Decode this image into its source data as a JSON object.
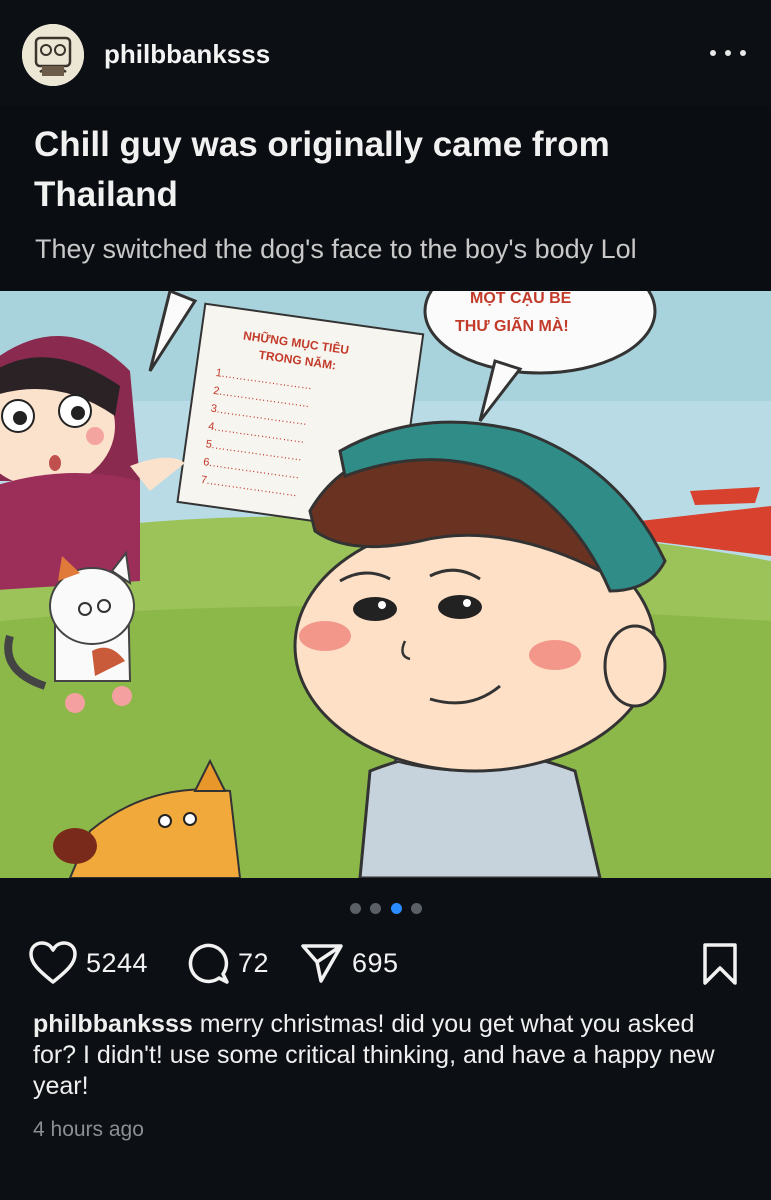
{
  "header": {
    "username": "philbbanksss",
    "more_icon": "more-horizontal-icon"
  },
  "embedded_post": {
    "title": "Chill guy was originally came from Thailand",
    "subtitle": "They switched the dog's face to the boy's body Lol",
    "image": {
      "paper_heading": "NHỮNG MỤC TIÊU TRONG NĂM:",
      "paper_items": [
        "1.",
        "2.",
        "3.",
        "4.",
        "5.",
        "6.",
        "7."
      ],
      "speech_bubble": "MỘT CẬU BÉ THƯ GIÃN MÀ!"
    }
  },
  "carousel": {
    "total": 4,
    "active_index": 2
  },
  "actions": {
    "likes": "5244",
    "comments": "72",
    "shares": "695"
  },
  "caption": {
    "username": "philbbanksss",
    "text": "merry christmas! did you get what you asked for? I didn't! use some critical thinking, and have a happy new year!"
  },
  "timestamp": "4 hours ago",
  "colors": {
    "background": "#0c0f14",
    "accent_dot": "#2b8cff"
  }
}
